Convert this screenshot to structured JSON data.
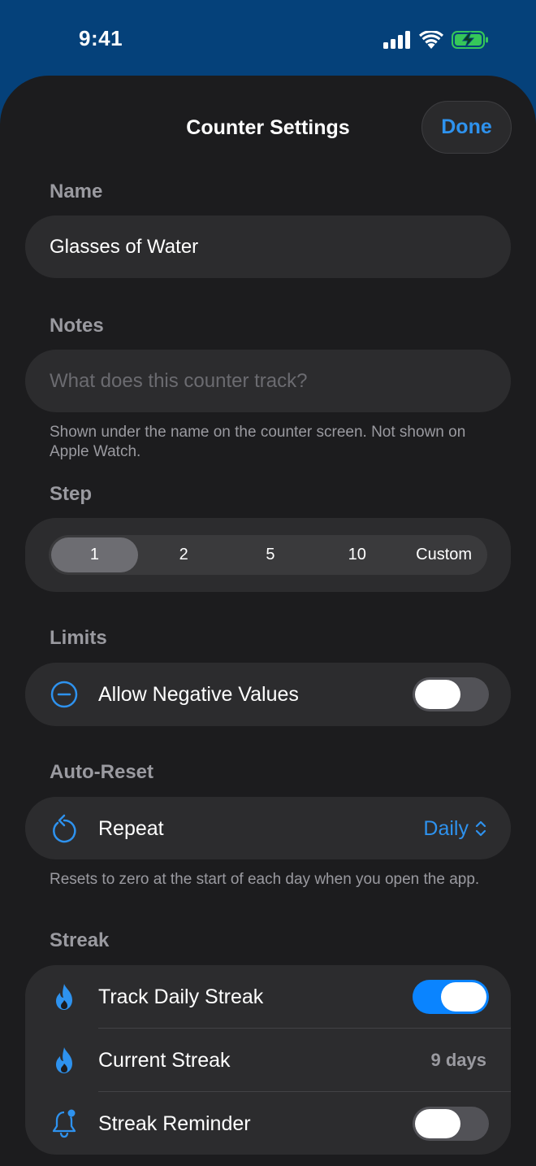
{
  "status": {
    "time": "9:41"
  },
  "header": {
    "title": "Counter Settings",
    "done_label": "Done"
  },
  "name_section": {
    "label": "Name",
    "value": "Glasses of Water"
  },
  "notes_section": {
    "label": "Notes",
    "placeholder": "What does this counter track?",
    "help": "Shown under the name on the counter screen. Not shown on Apple Watch."
  },
  "step_section": {
    "label": "Step",
    "options": [
      "1",
      "2",
      "5",
      "10",
      "Custom"
    ],
    "selected": "1"
  },
  "limits_section": {
    "label": "Limits",
    "allow_negative_label": "Allow Negative Values",
    "allow_negative_on": false
  },
  "auto_reset_section": {
    "label": "Auto-Reset",
    "repeat_label": "Repeat",
    "repeat_value": "Daily",
    "help": "Resets to zero at the start of each day when you open the app."
  },
  "streak_section": {
    "label": "Streak",
    "track_label": "Track Daily Streak",
    "track_on": true,
    "current_label": "Current Streak",
    "current_value": "9 days",
    "reminder_label": "Streak Reminder",
    "reminder_on": false
  },
  "colors": {
    "accent": "#2e92ee",
    "background": "#1c1c1e",
    "card": "#2c2c2e",
    "status_bar": "#05417a"
  }
}
